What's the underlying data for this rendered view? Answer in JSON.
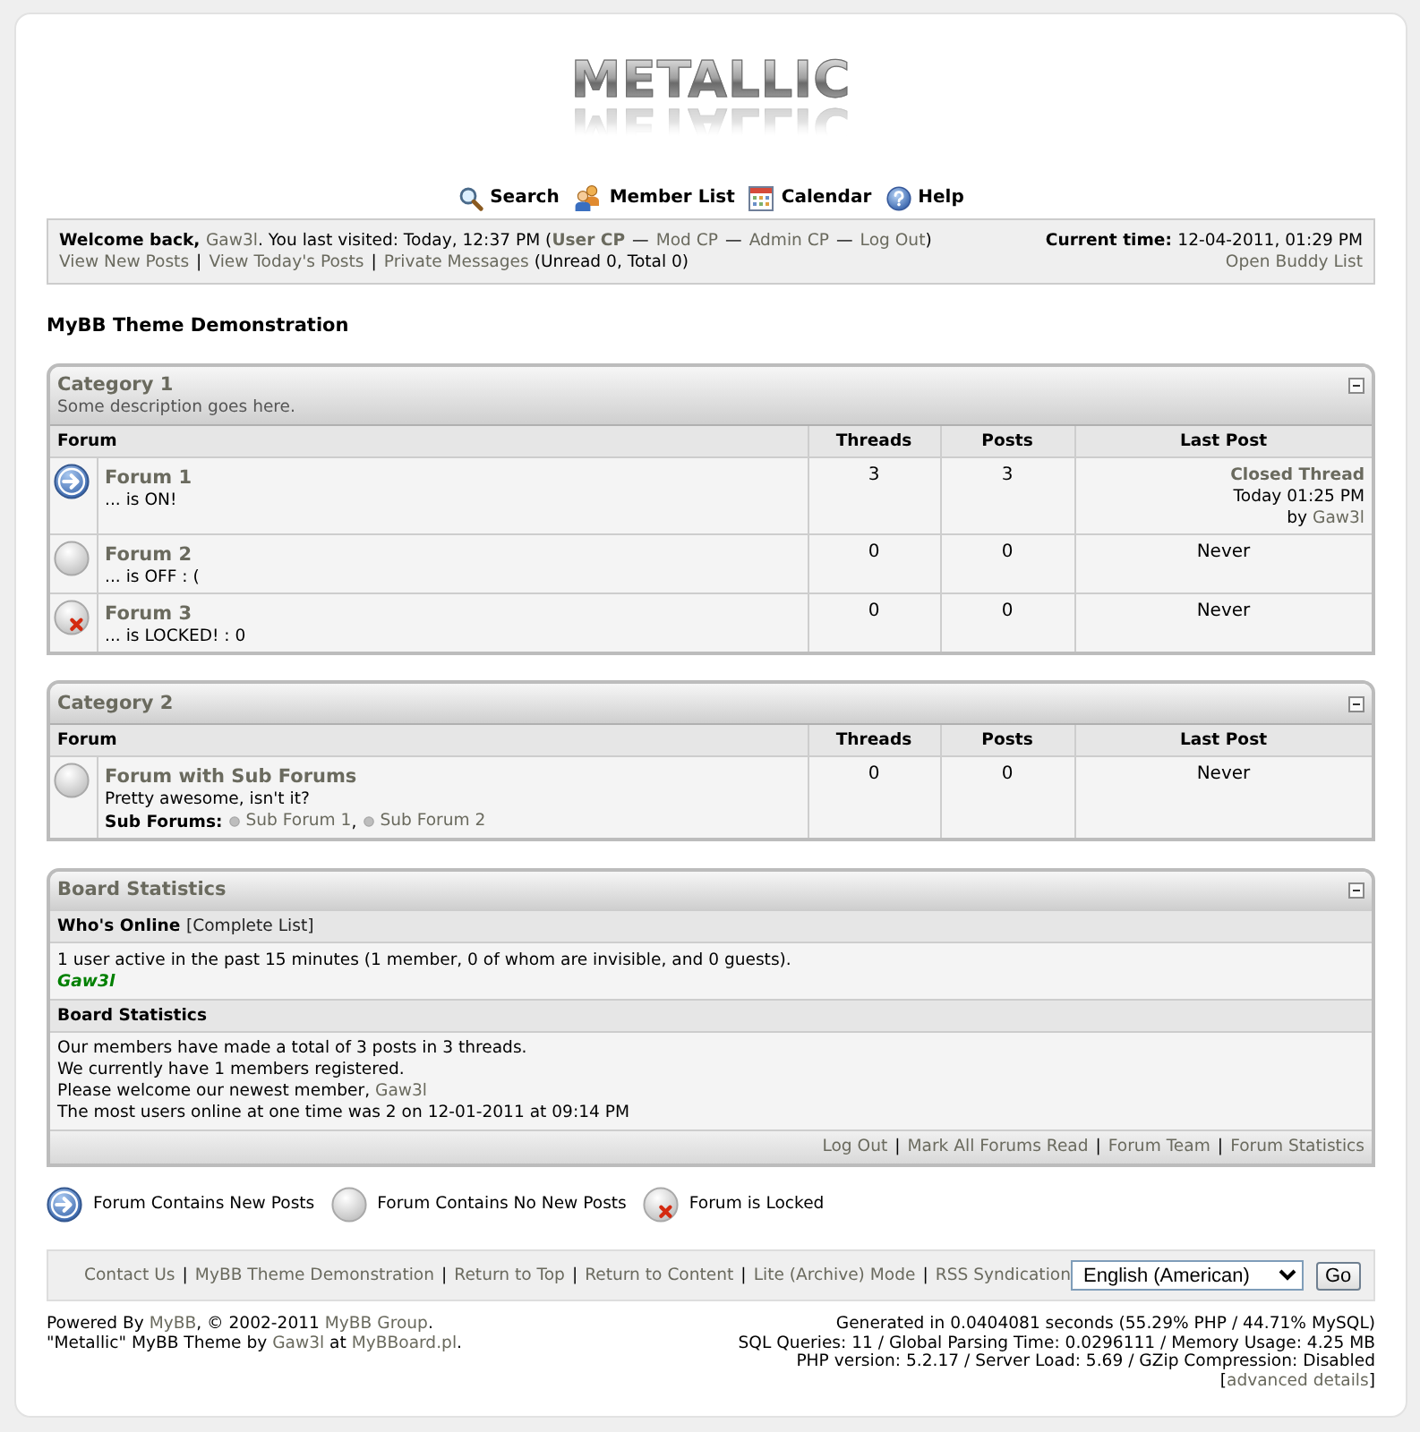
{
  "logo": {
    "text": "METALLIC"
  },
  "top_menu": [
    {
      "kind": "search",
      "label": "Search"
    },
    {
      "kind": "members",
      "label": "Member List"
    },
    {
      "kind": "calendar",
      "label": "Calendar"
    },
    {
      "kind": "help",
      "label": "Help"
    }
  ],
  "welcome_panel": {
    "line_1": [
      {
        "kind": "bold",
        "text": "Welcome back, "
      },
      {
        "kind": "link",
        "text": "Gaw3l"
      },
      {
        "kind": "text",
        "text": ". You last visited: Today, 12:37 PM ("
      },
      {
        "kind": "bold_link",
        "text": "User CP"
      },
      {
        "kind": "sep",
        "text": "—"
      },
      {
        "kind": "link",
        "text": "Mod CP"
      },
      {
        "kind": "sep",
        "text": "—"
      },
      {
        "kind": "link",
        "text": "Admin CP"
      },
      {
        "kind": "sep",
        "text": "—"
      },
      {
        "kind": "link",
        "text": "Log Out"
      },
      {
        "kind": "text",
        "text": ")"
      }
    ],
    "line_2": [
      {
        "kind": "link",
        "text": "View New Posts"
      },
      {
        "kind": "sep",
        "text": "|"
      },
      {
        "kind": "link",
        "text": "View Today's Posts"
      },
      {
        "kind": "sep",
        "text": "|"
      },
      {
        "kind": "link",
        "text": "Private Messages"
      },
      {
        "kind": "text",
        "text": " (Unread 0, Total 0)"
      }
    ],
    "current_time": [
      {
        "kind": "bold",
        "text": "Current time: "
      },
      {
        "kind": "text",
        "text": "12-04-2011, 01:29 PM"
      }
    ],
    "buddy_list_link": "Open Buddy List"
  },
  "page_title": "MyBB Theme Demonstration",
  "categories": [
    {
      "title": "Category 1",
      "description": "Some description goes here.",
      "expanded": true,
      "columns": [
        "Forum",
        "Threads",
        "Posts",
        "Last Post"
      ],
      "forums": [
        {
          "kind": "new",
          "name": "Forum 1",
          "description": "... is ON!",
          "threads": "3",
          "posts": "3",
          "last_post": {
            "kind": "post",
            "thread": "Closed Thread",
            "time": "Today 01:25 PM",
            "by": "by",
            "author": "Gaw3l"
          }
        },
        {
          "kind": "no_new",
          "name": "Forum 2",
          "description": "... is OFF : (",
          "threads": "0",
          "posts": "0",
          "last_post": {
            "kind": "never",
            "text": "Never"
          }
        },
        {
          "kind": "locked",
          "name": "Forum 3",
          "description": "... is LOCKED! : 0",
          "threads": "0",
          "posts": "0",
          "last_post": {
            "kind": "never",
            "text": "Never"
          }
        }
      ]
    },
    {
      "title": "Category 2",
      "expanded": true,
      "columns": [
        "Forum",
        "Threads",
        "Posts",
        "Last Post"
      ],
      "forums": [
        {
          "kind": "no_new",
          "name": "Forum with Sub Forums",
          "description": "Pretty awesome, isn't it?",
          "sub_forums": {
            "label": "Sub Forums:",
            "separator": ",",
            "items": [
              {
                "name": "Sub Forum 1",
                "kind": "no_new"
              },
              {
                "name": "Sub Forum 2",
                "kind": "no_new"
              }
            ]
          },
          "threads": "0",
          "posts": "0",
          "last_post": {
            "kind": "never",
            "text": "Never"
          }
        }
      ]
    }
  ],
  "board_statistics": {
    "title": "Board Statistics",
    "expanded": true,
    "whos_online": {
      "heading": "Who's Online",
      "complete_list_link": "[Complete List]",
      "summary": "1 user active in the past 15 minutes (1 member, 0 of whom are invisible, and 0 guests).",
      "users": [
        {
          "name": "Gaw3l",
          "color": "#008000"
        }
      ]
    },
    "statistics": {
      "heading": "Board Statistics",
      "lines": [
        [
          {
            "kind": "text",
            "text": "Our members have made a total of 3 posts in 3 threads."
          }
        ],
        [
          {
            "kind": "text",
            "text": "We currently have 1 members registered."
          }
        ],
        [
          {
            "kind": "text",
            "text": "Please welcome our newest member, "
          },
          {
            "kind": "link",
            "text": "Gaw3l"
          }
        ],
        [
          {
            "kind": "text",
            "text": "The most users online at one time was 2 on 12-01-2011 at 09:14 PM"
          }
        ]
      ]
    },
    "footer_links": [
      {
        "kind": "link",
        "text": "Log Out"
      },
      {
        "kind": "sep",
        "text": "|"
      },
      {
        "kind": "link",
        "text": "Mark All Forums Read"
      },
      {
        "kind": "sep",
        "text": "|"
      },
      {
        "kind": "link",
        "text": "Forum Team"
      },
      {
        "kind": "sep",
        "text": "|"
      },
      {
        "kind": "link",
        "text": "Forum Statistics"
      }
    ]
  },
  "legend": [
    {
      "kind": "new",
      "label": "Forum Contains New Posts"
    },
    {
      "kind": "no_new",
      "label": "Forum Contains No New Posts"
    },
    {
      "kind": "locked",
      "label": "Forum is Locked"
    }
  ],
  "footer_bar": {
    "links": [
      {
        "kind": "link",
        "text": "Contact Us"
      },
      {
        "kind": "sep",
        "text": "|"
      },
      {
        "kind": "link",
        "text": "MyBB Theme Demonstration"
      },
      {
        "kind": "sep",
        "text": "|"
      },
      {
        "kind": "link",
        "text": "Return to Top"
      },
      {
        "kind": "sep",
        "text": "|"
      },
      {
        "kind": "link",
        "text": "Return to Content"
      },
      {
        "kind": "sep",
        "text": "|"
      },
      {
        "kind": "link",
        "text": "Lite (Archive) Mode"
      },
      {
        "kind": "sep",
        "text": "|"
      },
      {
        "kind": "link",
        "text": "RSS Syndication"
      }
    ],
    "language": "English (American)",
    "go_button": "Go"
  },
  "copyright": [
    [
      {
        "kind": "text",
        "text": "Powered By "
      },
      {
        "kind": "link",
        "text": "MyBB"
      },
      {
        "kind": "text",
        "text": ", © 2002-2011 "
      },
      {
        "kind": "link",
        "text": "MyBB Group"
      },
      {
        "kind": "text",
        "text": "."
      }
    ],
    [
      {
        "kind": "text",
        "text": "\"Metallic\" MyBB Theme by "
      },
      {
        "kind": "link",
        "text": "Gaw3l"
      },
      {
        "kind": "text",
        "text": " at "
      },
      {
        "kind": "link",
        "text": "MyBBoard.pl"
      },
      {
        "kind": "text",
        "text": "."
      }
    ]
  ],
  "debug_info": [
    [
      {
        "kind": "text",
        "text": "Generated in 0.0404081 seconds (55.29% PHP / 44.71% MySQL)"
      }
    ],
    [
      {
        "kind": "text",
        "text": "SQL Queries: 11 / Global Parsing Time: 0.0296111 / Memory Usage: 4.25 MB"
      }
    ],
    [
      {
        "kind": "text",
        "text": "PHP version: 5.2.17 / Server Load: 5.69 / GZip Compression: Disabled"
      }
    ],
    [
      {
        "kind": "text",
        "text": "["
      },
      {
        "kind": "link",
        "text": "advanced details"
      },
      {
        "kind": "text",
        "text": "]"
      }
    ]
  ]
}
